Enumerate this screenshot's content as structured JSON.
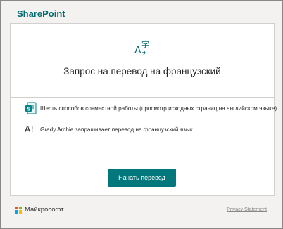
{
  "app": {
    "brand": "SharePoint"
  },
  "main": {
    "heading": "Запрос на перевод на французский",
    "icon": "translate-icon"
  },
  "details": {
    "page_text": "Шесть способов совместной работы (просмотр исходных страниц на английском языке)",
    "page_icon": "sharepoint-page-icon",
    "request_text": "Grady Archie запрашивает перевод на французский язык",
    "request_icon": "language-icon"
  },
  "actions": {
    "start_label": "Начать перевод"
  },
  "footer": {
    "company": "Майкрософт",
    "privacy_label": "Privacy Statement"
  },
  "colors": {
    "brand": "#036c70",
    "button": "#03787c",
    "ms_red": "#f25022",
    "ms_green": "#7fba00",
    "ms_blue": "#00a4ef",
    "ms_yellow": "#ffb900"
  }
}
